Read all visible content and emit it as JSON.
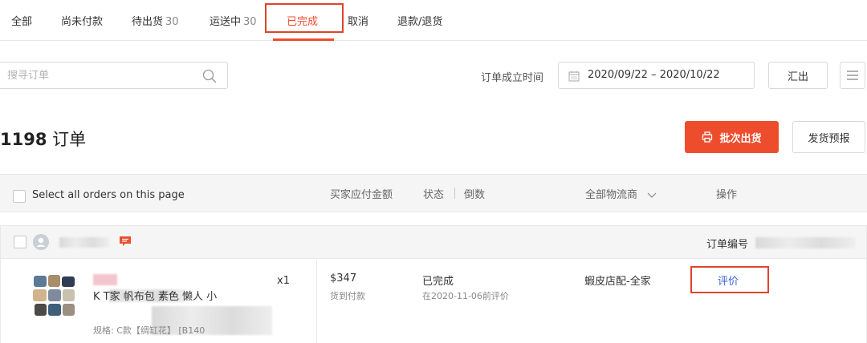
{
  "tabs": [
    {
      "label": "全部",
      "count": ""
    },
    {
      "label": "尚未付款",
      "count": ""
    },
    {
      "label": "待出货",
      "count": "30"
    },
    {
      "label": "运送中",
      "count": "30"
    },
    {
      "label": "已完成",
      "count": ""
    },
    {
      "label": "取消",
      "count": ""
    },
    {
      "label": "退款/退货",
      "count": ""
    }
  ],
  "active_tab": "已完成",
  "search": {
    "placeholder": "搜寻订单",
    "value": ""
  },
  "date_filter": {
    "label": "订单成立时间",
    "range": "2020/09/22 – 2020/10/22"
  },
  "export_label": "汇出",
  "order_count": {
    "number": "1198",
    "unit": "订单"
  },
  "batch_ship_label": "批次出货",
  "ship_report_label": "发货预报",
  "table_header": {
    "select_all": "Select all orders on this page",
    "amount": "买家应付金额",
    "status": "状态",
    "countdown": "倒数",
    "logistics": "全部物流商",
    "actions": "操作"
  },
  "order": {
    "order_no_label": "订单编号",
    "product_name": "K T家 帆布包 素色 懒人 小",
    "product_spec": "规格: C款【绸缸花】 [B140",
    "quantity": "x1",
    "amount": "$347",
    "payment_method": "货到付款",
    "status": "已完成",
    "status_note": "在2020-11-06前评价",
    "logistics": "蝦皮店配-全家",
    "action": "评价"
  },
  "colors": {
    "accent": "#ee4d2d",
    "link": "#3a63d6",
    "highlight_box": "#e0442a"
  },
  "icons": [
    "search-icon",
    "calendar-icon",
    "menu-icon",
    "printer-icon",
    "chevron-down-icon",
    "user-icon",
    "chat-icon"
  ]
}
